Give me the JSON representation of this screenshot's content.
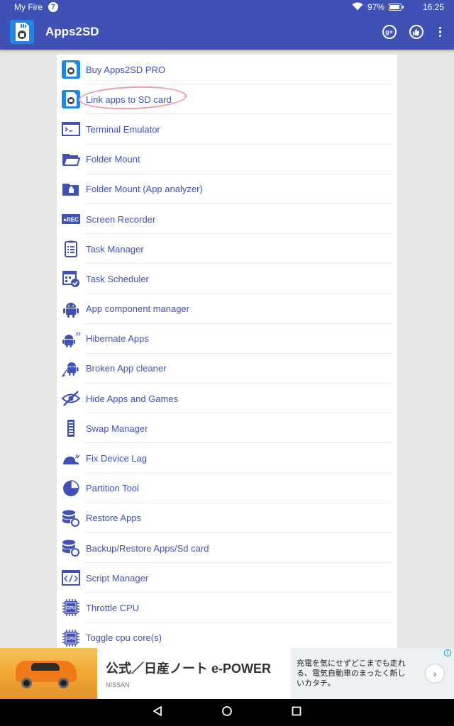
{
  "status_bar": {
    "carrier": "My Fire",
    "notification_count": "7",
    "battery_text": "97%",
    "battery_level": 0.97,
    "time": "16:25"
  },
  "app_bar": {
    "title": "Apps2SD",
    "actions": [
      "google-plus-icon",
      "thumbs-up-icon",
      "overflow-menu-icon"
    ]
  },
  "menu": {
    "items": [
      {
        "label": "Buy Apps2SD PRO",
        "icon": "apps2sd-logo-icon"
      },
      {
        "label": "Link apps to SD card",
        "icon": "apps2sd-logo-icon"
      },
      {
        "label": "Terminal Emulator",
        "icon": "terminal-icon"
      },
      {
        "label": "Folder Mount",
        "icon": "folder-icon"
      },
      {
        "label": "Folder Mount (App analyzer)",
        "icon": "folder-analyzer-icon"
      },
      {
        "label": "Screen Recorder",
        "icon": "rec-icon",
        "icon_text": "●REC"
      },
      {
        "label": "Task Manager",
        "icon": "checklist-icon"
      },
      {
        "label": "Task Scheduler",
        "icon": "calendar-check-icon"
      },
      {
        "label": "App component manager",
        "icon": "android-icon"
      },
      {
        "label": "Hibernate Apps",
        "icon": "android-sleep-icon"
      },
      {
        "label": "Broken App cleaner",
        "icon": "android-broom-icon"
      },
      {
        "label": "Hide Apps and Games",
        "icon": "eye-off-icon"
      },
      {
        "label": "Swap Manager",
        "icon": "memory-stick-icon"
      },
      {
        "label": "Fix Device Lag",
        "icon": "snail-icon"
      },
      {
        "label": "Partition Tool",
        "icon": "pie-chart-icon"
      },
      {
        "label": "Restore Apps",
        "icon": "database-restore-icon"
      },
      {
        "label": "Backup/Restore Apps/Sd card",
        "icon": "database-backup-icon"
      },
      {
        "label": "Script Manager",
        "icon": "code-window-icon"
      },
      {
        "label": "Throttle CPU",
        "icon": "cpu-icon",
        "icon_text": "CPU"
      },
      {
        "label": "Toggle cpu core(s)",
        "icon": "cpu-icon",
        "icon_text": "CPU"
      }
    ]
  },
  "ad": {
    "title": "公式／日産ノート e-POWER",
    "brand": "NISSAN",
    "description": "充電を気にせずどこまでも走れる、電気自動車のまったく新しいカタチ。",
    "info_symbol": "i",
    "next_symbol": "›"
  },
  "nav_bar": {
    "buttons": [
      "back-icon",
      "home-icon",
      "recents-icon"
    ]
  },
  "colors": {
    "primary": "#3f51b5",
    "background": "#e6e6e6",
    "highlight": "#ef9aa6"
  }
}
